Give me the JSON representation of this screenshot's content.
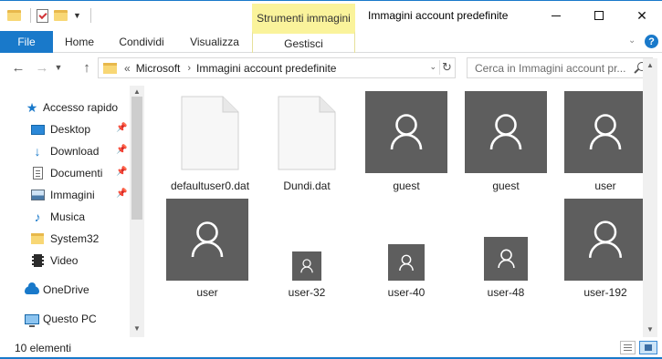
{
  "window": {
    "title": "Immagini account predefinite",
    "contextual_tab_group": "Strumenti immagini",
    "accent_color": "#1979ca",
    "contextual_color": "#faf39b"
  },
  "ribbon": {
    "tabs": [
      {
        "label": "File"
      },
      {
        "label": "Home"
      },
      {
        "label": "Condividi"
      },
      {
        "label": "Visualizza"
      },
      {
        "label": "Gestisci"
      }
    ],
    "help_label": "?"
  },
  "address": {
    "overflow": "«",
    "crumbs": [
      "Microsoft",
      "Immagini account predefinite"
    ]
  },
  "search": {
    "placeholder": "Cerca in Immagini account pr..."
  },
  "navpane": {
    "items": [
      {
        "label": "Accesso rapido",
        "icon": "star-icon"
      },
      {
        "label": "Desktop",
        "icon": "desktop-icon",
        "pinned": true
      },
      {
        "label": "Download",
        "icon": "download-icon",
        "pinned": true
      },
      {
        "label": "Documenti",
        "icon": "documents-icon",
        "pinned": true
      },
      {
        "label": "Immagini",
        "icon": "pictures-icon",
        "pinned": true
      },
      {
        "label": "Musica",
        "icon": "music-icon"
      },
      {
        "label": "System32",
        "icon": "folder-icon"
      },
      {
        "label": "Video",
        "icon": "video-icon"
      },
      {
        "label": "OneDrive",
        "icon": "onedrive-icon"
      },
      {
        "label": "Questo PC",
        "icon": "this-pc-icon"
      }
    ]
  },
  "files": [
    {
      "name": "defaultuser0.dat",
      "type": "dat"
    },
    {
      "name": "Dundi.dat",
      "type": "dat"
    },
    {
      "name": "guest",
      "type": "image"
    },
    {
      "name": "guest",
      "type": "image"
    },
    {
      "name": "user",
      "type": "image"
    },
    {
      "name": "user",
      "type": "image"
    },
    {
      "name": "user-32",
      "type": "image"
    },
    {
      "name": "user-40",
      "type": "image"
    },
    {
      "name": "user-48",
      "type": "image"
    },
    {
      "name": "user-192",
      "type": "image"
    }
  ],
  "status": {
    "item_count": "10 elementi"
  }
}
